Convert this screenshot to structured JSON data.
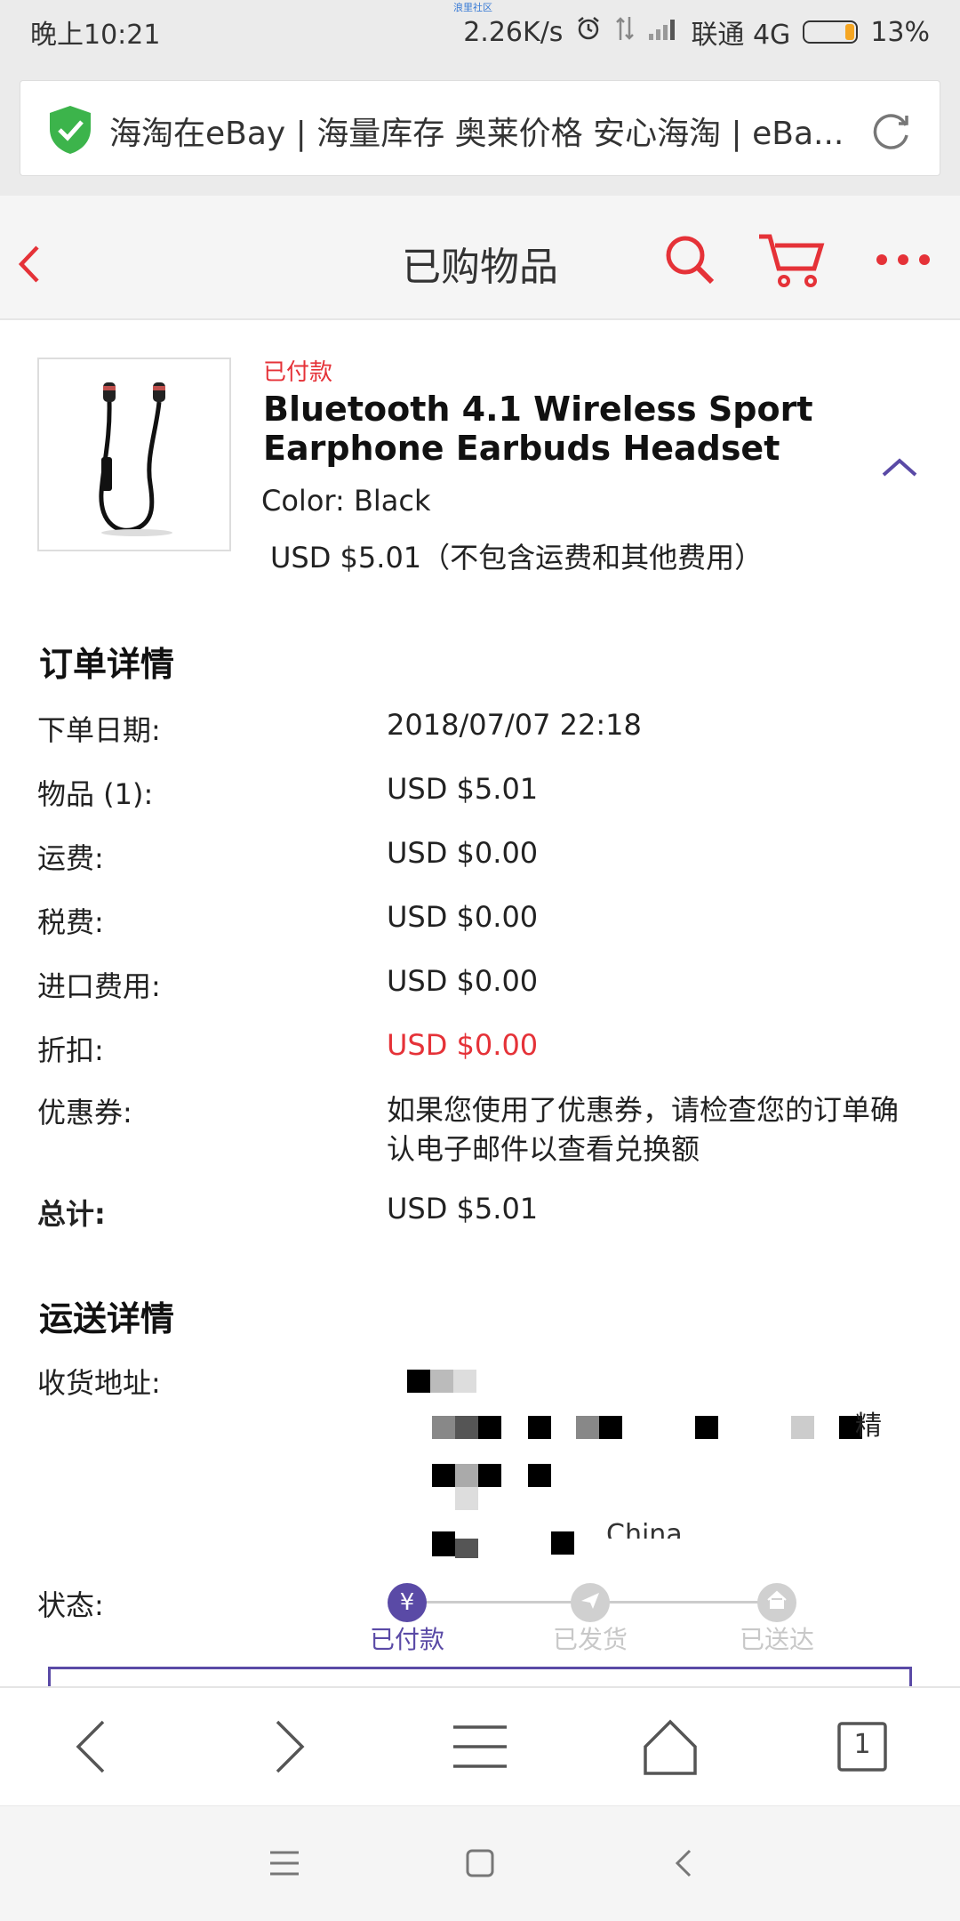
{
  "status_bar": {
    "time": "晚上10:21",
    "top_tiny_text": "浪里社区",
    "speed": "2.26K/s",
    "carrier": "联通 4G",
    "battery": "13%"
  },
  "browser": {
    "url_title": "海淘在eBay | 海量库存 奥莱价格 安心海淘 | eBa..."
  },
  "header": {
    "title": "已购物品"
  },
  "item": {
    "status": "已付款",
    "title": "Bluetooth 4.1 Wireless Sport Earphone Earbuds Headset",
    "color": "Color: Black",
    "price": "USD $5.01（不包含运费和其他费用）"
  },
  "order_details": {
    "title": "订单详情",
    "rows": [
      {
        "label": "下单日期:",
        "value": "2018/07/07 22:18"
      },
      {
        "label": "物品 (1):",
        "value": "USD $5.01"
      },
      {
        "label": "运费:",
        "value": "USD $0.00"
      },
      {
        "label": "税费:",
        "value": "USD $0.00"
      },
      {
        "label": "进口费用:",
        "value": "USD $0.00"
      },
      {
        "label": "折扣:",
        "value": "USD $0.00"
      },
      {
        "label": "优惠券:",
        "value": "如果您使用了优惠券，请检查您的订单确认电子邮件以查看兑换额"
      },
      {
        "label": "总计:",
        "value": "USD $5.01"
      }
    ]
  },
  "shipping": {
    "title": "运送详情",
    "address_label": "收货地址:",
    "address_fragment_1": "精",
    "address_fragment_2": "China",
    "status_label": "状态:",
    "steps": [
      "已付款",
      "已发货",
      "已送达"
    ],
    "yen_symbol": "¥"
  },
  "browser_nav": {
    "tab_count": "1"
  },
  "colors": {
    "accent_red": "#e53238",
    "accent_purple": "#5a4aa6",
    "inactive_gray": "#c8c8c8"
  }
}
